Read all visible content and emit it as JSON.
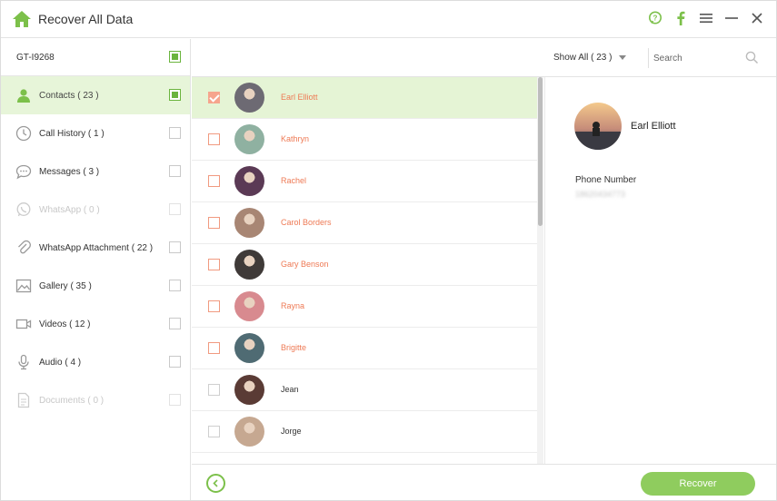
{
  "app": {
    "title": "Recover All Data",
    "accent": "#7cc04a"
  },
  "titlebar": {
    "icons": [
      "help-icon",
      "facebook-icon",
      "menu-icon",
      "minimize-icon",
      "close-icon"
    ]
  },
  "sidebar": {
    "device": {
      "name": "GT-I9268",
      "checked": true
    },
    "items": [
      {
        "label": "Contacts ( 23 )",
        "icon": "contact-icon",
        "active": true,
        "checked": true,
        "disabled": false
      },
      {
        "label": "Call History ( 1 )",
        "icon": "clock-icon",
        "active": false,
        "checked": false,
        "disabled": false
      },
      {
        "label": "Messages ( 3 )",
        "icon": "message-icon",
        "active": false,
        "checked": false,
        "disabled": false
      },
      {
        "label": "WhatsApp ( 0 )",
        "icon": "whatsapp-icon",
        "active": false,
        "checked": false,
        "disabled": true
      },
      {
        "label": "WhatsApp Attachment ( 22 )",
        "icon": "paperclip-icon",
        "active": false,
        "checked": false,
        "disabled": false
      },
      {
        "label": "Gallery ( 35 )",
        "icon": "image-icon",
        "active": false,
        "checked": false,
        "disabled": false
      },
      {
        "label": "Videos ( 12 )",
        "icon": "video-icon",
        "active": false,
        "checked": false,
        "disabled": false
      },
      {
        "label": "Audio ( 4 )",
        "icon": "microphone-icon",
        "active": false,
        "checked": false,
        "disabled": false
      },
      {
        "label": "Documents ( 0 )",
        "icon": "document-icon",
        "active": false,
        "checked": false,
        "disabled": true
      }
    ]
  },
  "toolbar": {
    "filter_label": "Show All ( 23 )",
    "search_placeholder": "Search"
  },
  "contacts": [
    {
      "name": "Earl Elliott",
      "selected": true,
      "checked": true,
      "style": "orange",
      "avatar": "#6d6a73"
    },
    {
      "name": "Kathryn",
      "selected": false,
      "checked": false,
      "style": "orange",
      "avatar": "#8fb1a1"
    },
    {
      "name": "Rachel",
      "selected": false,
      "checked": false,
      "style": "orange",
      "avatar": "#5b3a55"
    },
    {
      "name": "Carol Borders",
      "selected": false,
      "checked": false,
      "style": "orange",
      "avatar": "#a88674"
    },
    {
      "name": "Gary Benson",
      "selected": false,
      "checked": false,
      "style": "orange",
      "avatar": "#3f3a38"
    },
    {
      "name": "Rayna",
      "selected": false,
      "checked": false,
      "style": "orange",
      "avatar": "#d88a8f"
    },
    {
      "name": "Brigitte",
      "selected": false,
      "checked": false,
      "style": "orange",
      "avatar": "#4f6b73"
    },
    {
      "name": "Jean",
      "selected": false,
      "checked": false,
      "style": "dark",
      "avatar": "#5a3b35"
    },
    {
      "name": "Jorge",
      "selected": false,
      "checked": false,
      "style": "dark",
      "avatar": "#c6a891"
    }
  ],
  "detail": {
    "name": "Earl Elliott",
    "phone_label": "Phone Number",
    "phone_value": "18620434773"
  },
  "footer": {
    "recover_label": "Recover"
  }
}
